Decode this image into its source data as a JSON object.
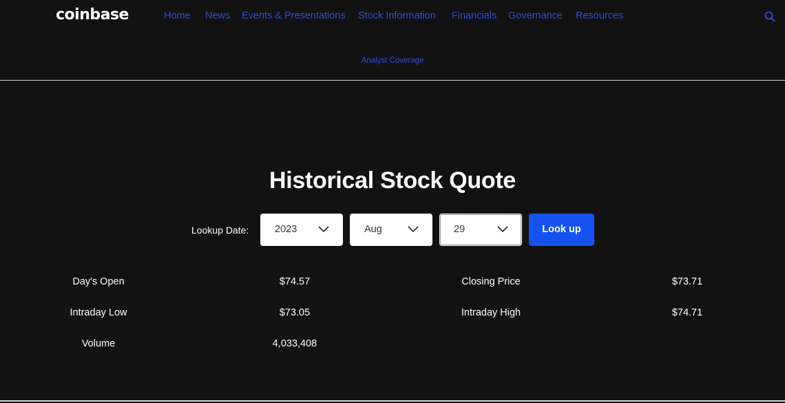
{
  "header": {
    "logo": "coinbase",
    "nav": [
      {
        "label": "Home"
      },
      {
        "label": "News"
      },
      {
        "label": "Events & Presentations"
      },
      {
        "label": "Stock Information"
      },
      {
        "label": "Financials"
      },
      {
        "label": "Governance"
      },
      {
        "label": "Resources"
      }
    ],
    "search_icon": "search-icon"
  },
  "subnav": {
    "items": [
      {
        "label": "Analyst Coverage"
      }
    ]
  },
  "colors": {
    "background": "#121212",
    "link": "#2b4fd6",
    "button": "#1652f0"
  },
  "main": {
    "title": "Historical Stock Quote",
    "lookup": {
      "label": "Lookup Date:",
      "year": "2023",
      "month": "Aug",
      "day": "29",
      "button": "Look up"
    },
    "stats": [
      {
        "label": "Day's Open",
        "value": "$74.57"
      },
      {
        "label": "Closing Price",
        "value": "$73.71"
      },
      {
        "label": "Intraday Low",
        "value": "$73.05"
      },
      {
        "label": "Intraday High",
        "value": "$74.71"
      },
      {
        "label": "Volume",
        "value": "4,033,408"
      }
    ]
  }
}
